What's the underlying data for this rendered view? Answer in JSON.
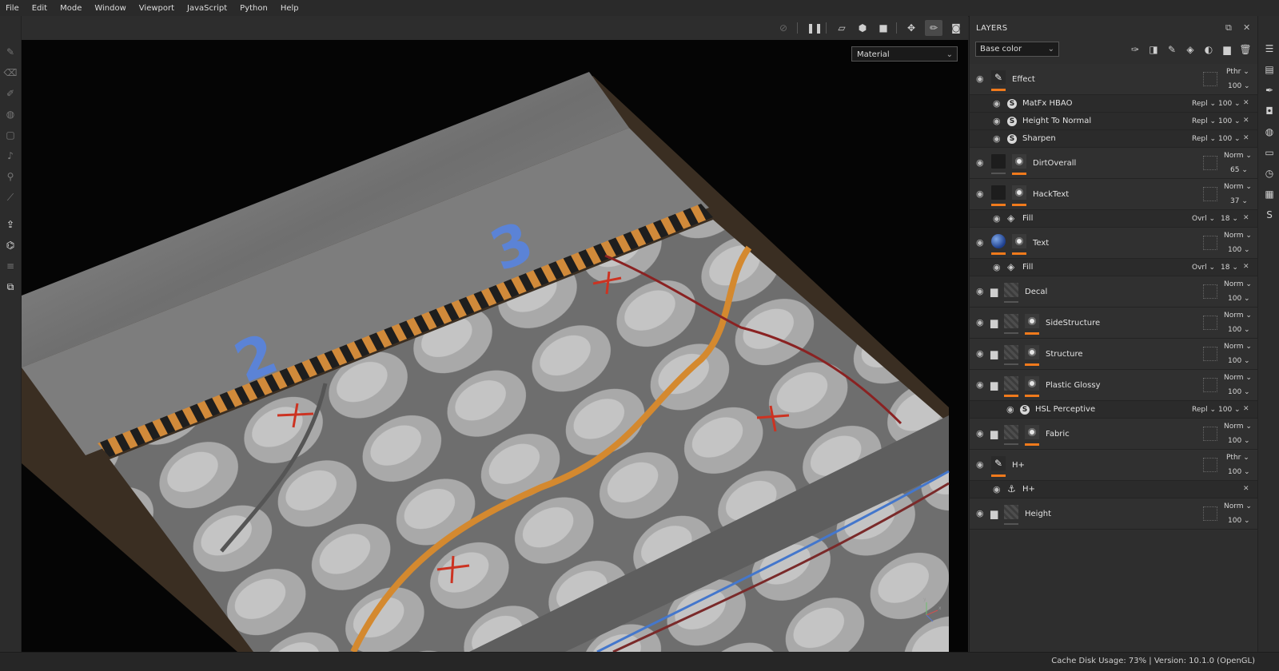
{
  "menu": [
    "File",
    "Edit",
    "Mode",
    "Window",
    "Viewport",
    "JavaScript",
    "Python",
    "Help"
  ],
  "viewport": {
    "display_mode": "Material",
    "gizmo_labels": {
      "x": "x",
      "y": "y"
    }
  },
  "panel": {
    "title": "LAYERS",
    "channel": "Base color"
  },
  "layers": [
    {
      "name": "Effect",
      "blend": "Pthr",
      "opacity": "100"
    },
    {
      "name": "MatFx HBAO",
      "blend": "Repl",
      "opacity": "100"
    },
    {
      "name": "Height To Normal",
      "blend": "Repl",
      "opacity": "100"
    },
    {
      "name": "Sharpen",
      "blend": "Repl",
      "opacity": "100"
    },
    {
      "name": "DirtOverall",
      "blend": "Norm",
      "opacity": "65"
    },
    {
      "name": "HackText",
      "blend": "Norm",
      "opacity": "37"
    },
    {
      "name": "Fill",
      "blend": "Ovrl",
      "opacity": "18"
    },
    {
      "name": "Text",
      "blend": "Norm",
      "opacity": "100"
    },
    {
      "name": "Fill",
      "blend": "Ovrl",
      "opacity": "18"
    },
    {
      "name": "Decal",
      "blend": "Norm",
      "opacity": "100"
    },
    {
      "name": "SideStructure",
      "blend": "Norm",
      "opacity": "100"
    },
    {
      "name": "Structure",
      "blend": "Norm",
      "opacity": "100"
    },
    {
      "name": "Plastic Glossy",
      "blend": "Norm",
      "opacity": "100"
    },
    {
      "name": "HSL Perceptive",
      "blend": "Repl",
      "opacity": "100"
    },
    {
      "name": "Fabric",
      "blend": "Norm",
      "opacity": "100"
    },
    {
      "name": "H+",
      "blend": "Pthr",
      "opacity": "100"
    },
    {
      "name": "H+"
    },
    {
      "name": "Height",
      "blend": "Norm",
      "opacity": "100"
    }
  ],
  "status": "Cache Disk Usage:   73% | Version: 10.1.0 (OpenGL)"
}
